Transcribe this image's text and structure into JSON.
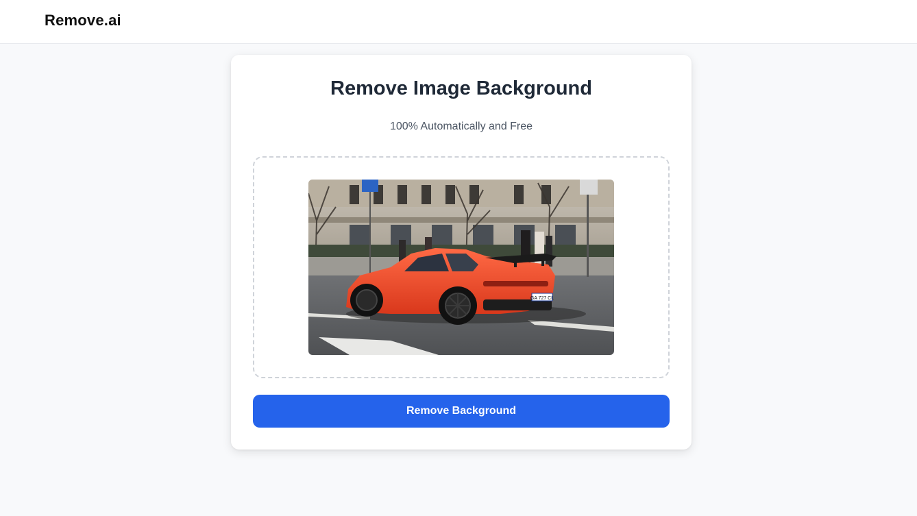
{
  "header": {
    "brand": "Remove.ai"
  },
  "main": {
    "title": "Remove Image Background",
    "subtitle": "100% Automatically and Free",
    "preview_image": {
      "alt": "Orange sports car parked on a city street",
      "plate_text": "GA 727 CL"
    },
    "action_button_label": "Remove Background"
  },
  "colors": {
    "primary": "#2563eb",
    "page_background": "#f8f9fb",
    "heading": "#1f2937",
    "muted_text": "#4b5563",
    "car": "#f04a2a"
  }
}
